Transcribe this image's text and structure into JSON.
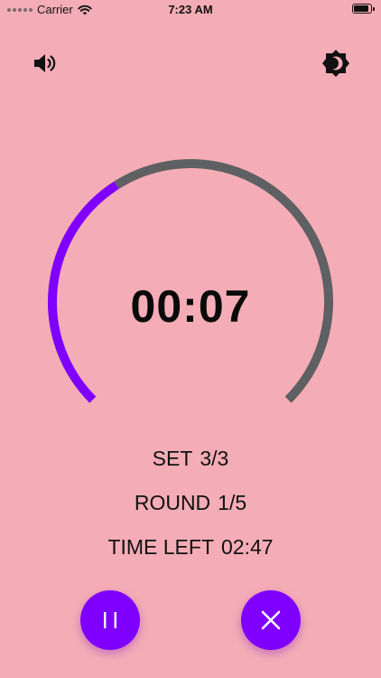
{
  "status_bar": {
    "carrier": "Carrier",
    "time": "7:23 AM"
  },
  "timer": {
    "display": "00:07",
    "progress_fraction": 0.38,
    "progress_color": "#8000ff",
    "track_color": "#5f6063"
  },
  "stats": {
    "set_label": "SET",
    "set_value": "3/3",
    "round_label": "ROUND",
    "round_value": "1/5",
    "time_left_label": "TIME LEFT",
    "time_left_value": "02:47"
  },
  "icons": {
    "sound": "speaker-icon",
    "theme": "dark-mode-icon",
    "pause": "pause-icon",
    "cancel": "close-icon"
  },
  "colors": {
    "background": "#f4adb6",
    "accent": "#8000ff"
  }
}
